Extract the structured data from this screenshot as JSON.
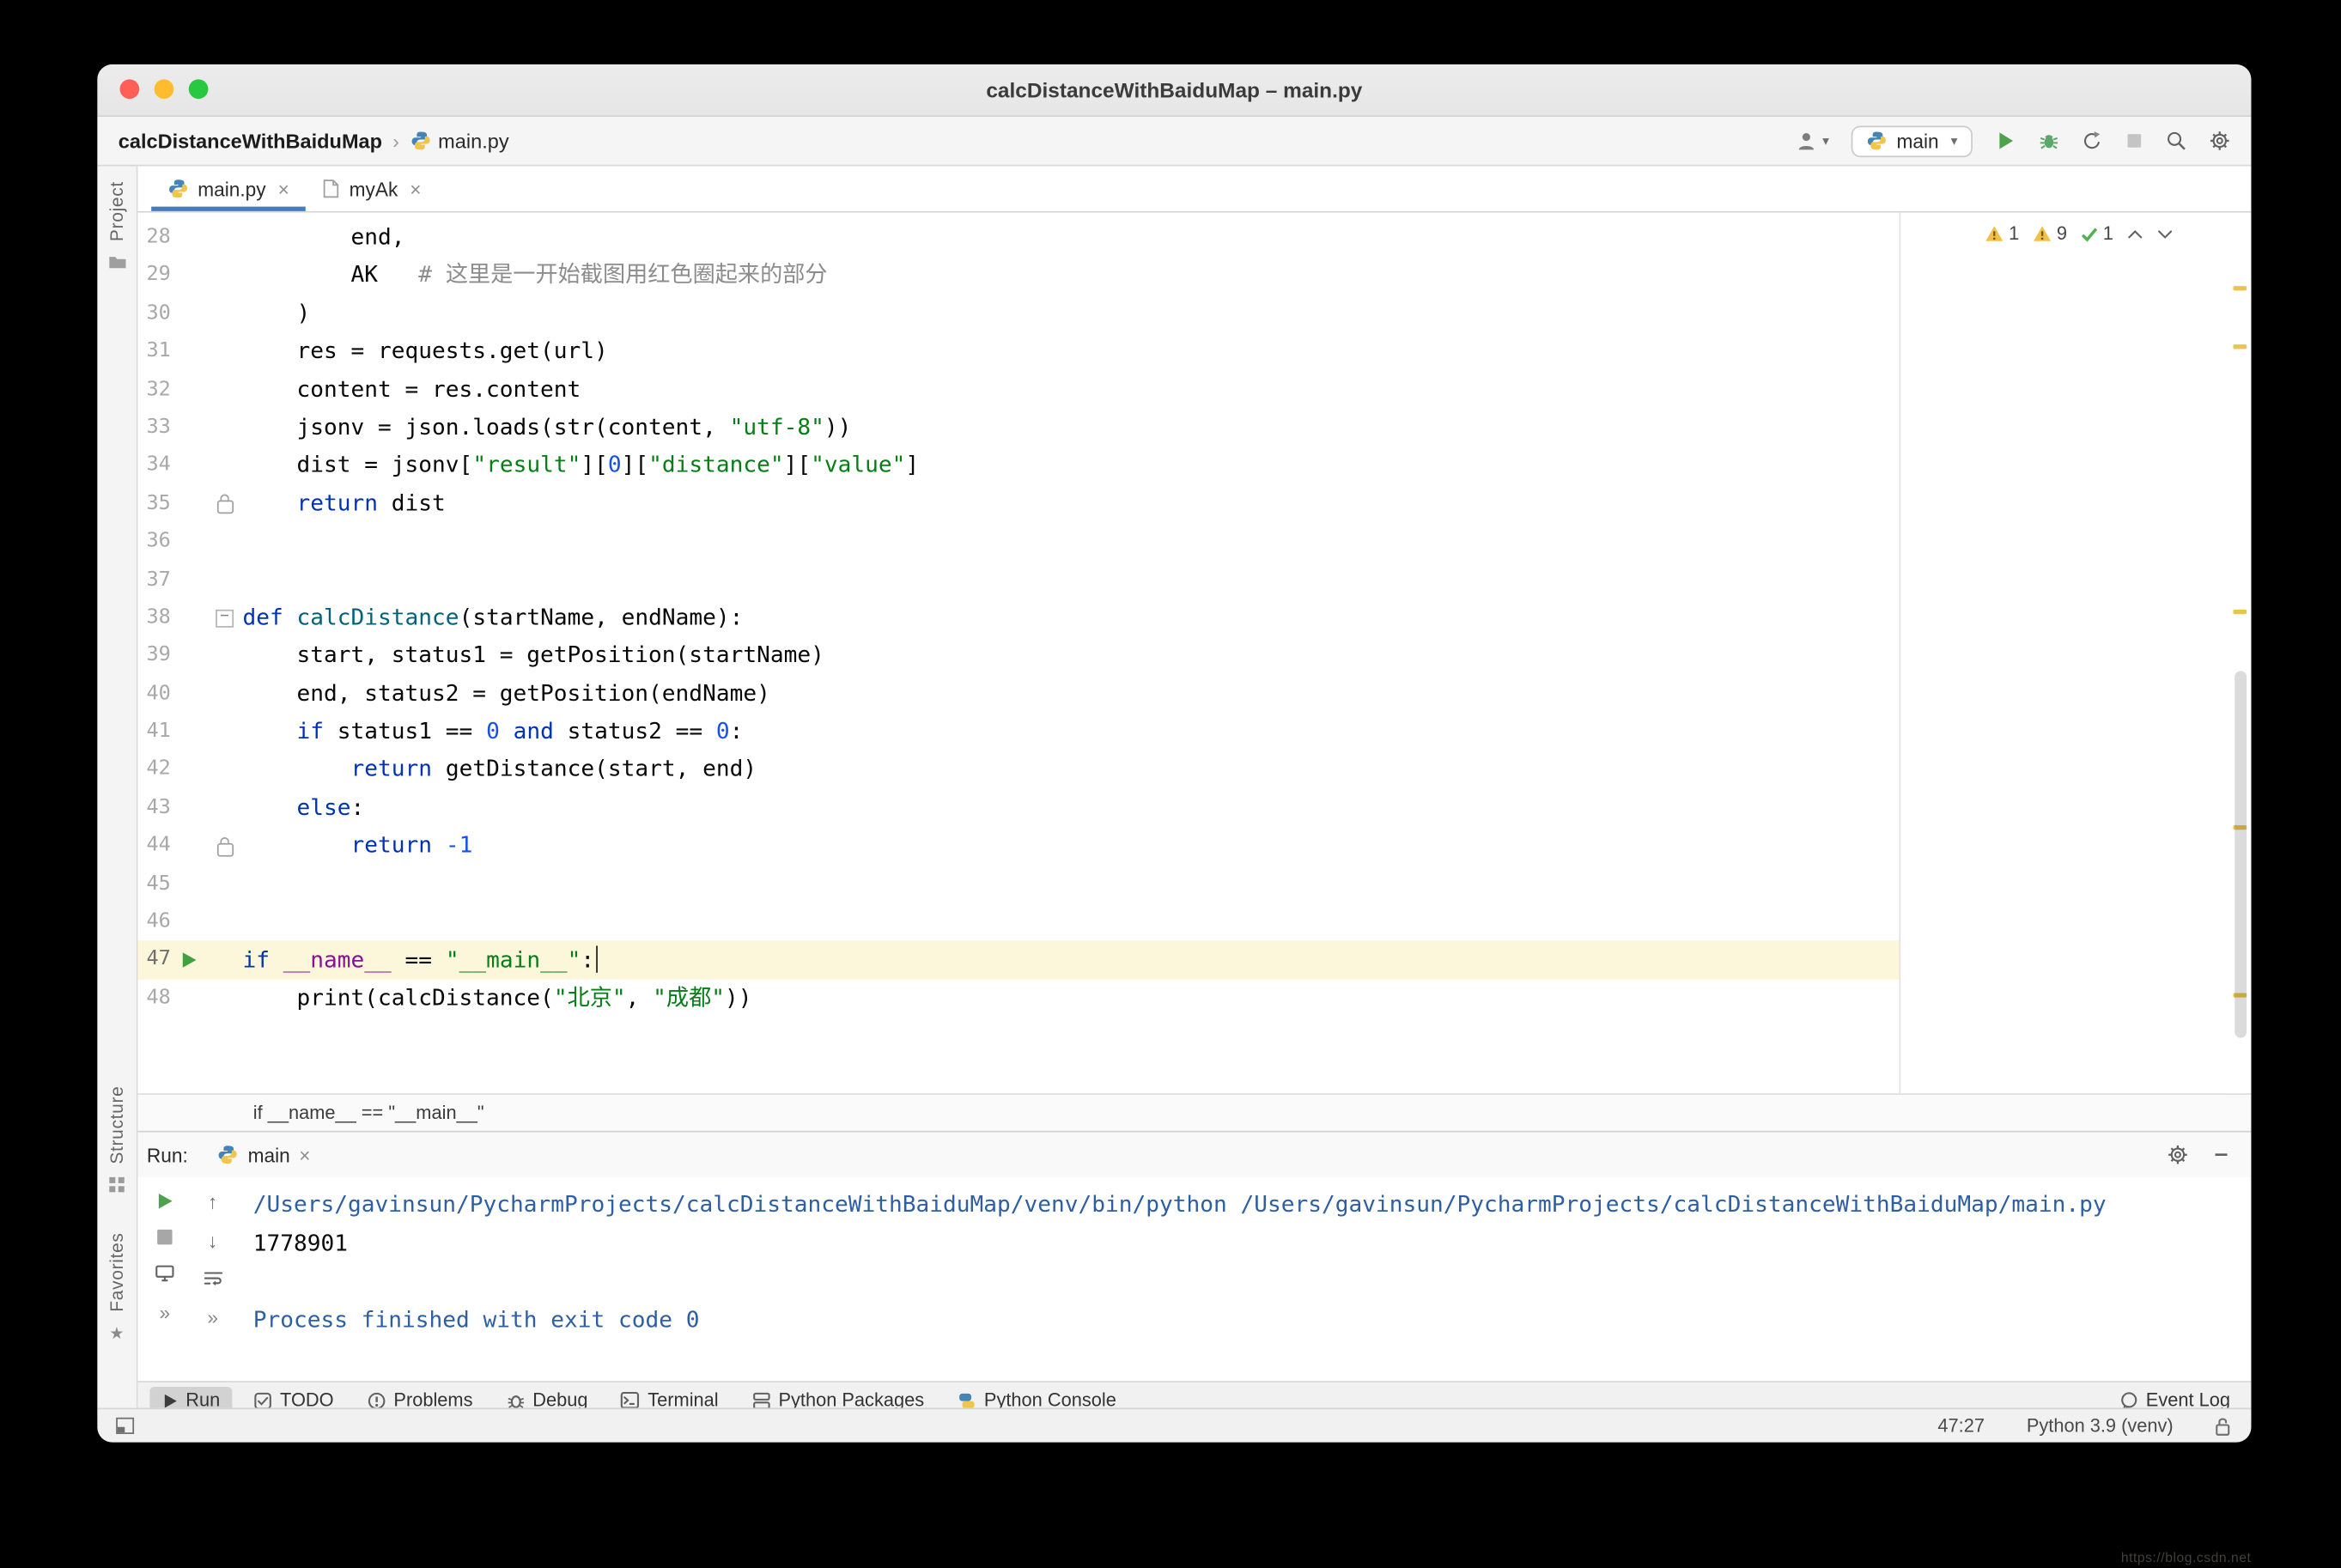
{
  "window": {
    "title": "calcDistanceWithBaiduMap – main.py"
  },
  "navbar": {
    "project": "calcDistanceWithBaiduMap",
    "separator": "›",
    "file": "main.py",
    "run_config": "main"
  },
  "tabs": [
    {
      "label": "main.py",
      "active": true
    },
    {
      "label": "myAk",
      "active": false
    }
  ],
  "inspections": {
    "warning1": "1",
    "warning2": "9",
    "passed": "1"
  },
  "side": {
    "project": "Project",
    "structure": "Structure",
    "favorites": "Favorites"
  },
  "editor": {
    "lines": [
      {
        "n": "28",
        "seg": [
          [
            "pln",
            "        end,"
          ]
        ]
      },
      {
        "n": "29",
        "seg": [
          [
            "pln",
            "        AK   "
          ],
          [
            "com",
            "# 这里是一开始截图用红色圈起来的部分"
          ]
        ]
      },
      {
        "n": "30",
        "seg": [
          [
            "pln",
            "    )"
          ]
        ]
      },
      {
        "n": "31",
        "seg": [
          [
            "pln",
            "    res = requests.get(url)"
          ]
        ]
      },
      {
        "n": "32",
        "seg": [
          [
            "pln",
            "    content = res.content"
          ]
        ]
      },
      {
        "n": "33",
        "seg": [
          [
            "pln",
            "    jsonv = json.loads(str(content, "
          ],
          [
            "str",
            "\"utf-8\""
          ],
          [
            "pln",
            "))"
          ]
        ]
      },
      {
        "n": "34",
        "seg": [
          [
            "pln",
            "    dist = jsonv["
          ],
          [
            "str",
            "\"result\""
          ],
          [
            "pln",
            "]["
          ],
          [
            "num",
            "0"
          ],
          [
            "pln",
            "]["
          ],
          [
            "str",
            "\"distance\""
          ],
          [
            "pln",
            "]["
          ],
          [
            "str",
            "\"value\""
          ],
          [
            "pln",
            "]"
          ]
        ]
      },
      {
        "n": "35",
        "g2": "lock",
        "seg": [
          [
            "pln",
            "    "
          ],
          [
            "kw",
            "return"
          ],
          [
            "pln",
            " dist"
          ]
        ]
      },
      {
        "n": "36",
        "seg": []
      },
      {
        "n": "37",
        "seg": []
      },
      {
        "n": "38",
        "g2": "fold",
        "seg": [
          [
            "kw",
            "def"
          ],
          [
            "pln",
            " "
          ],
          [
            "fn",
            "calcDistance"
          ],
          [
            "pln",
            "(startName, endName):"
          ]
        ]
      },
      {
        "n": "39",
        "seg": [
          [
            "pln",
            "    start, status1 = getPosition(startName)"
          ]
        ]
      },
      {
        "n": "40",
        "seg": [
          [
            "pln",
            "    end, status2 = getPosition(endName)"
          ]
        ]
      },
      {
        "n": "41",
        "seg": [
          [
            "pln",
            "    "
          ],
          [
            "kw",
            "if"
          ],
          [
            "pln",
            " status1 == "
          ],
          [
            "num",
            "0"
          ],
          [
            "pln",
            " "
          ],
          [
            "kw",
            "and"
          ],
          [
            "pln",
            " status2 == "
          ],
          [
            "num",
            "0"
          ],
          [
            "pln",
            ":"
          ]
        ]
      },
      {
        "n": "42",
        "seg": [
          [
            "pln",
            "        "
          ],
          [
            "kw",
            "return"
          ],
          [
            "pln",
            " getDistance(start, end)"
          ]
        ]
      },
      {
        "n": "43",
        "seg": [
          [
            "pln",
            "    "
          ],
          [
            "kw",
            "else"
          ],
          [
            "pln",
            ":"
          ]
        ]
      },
      {
        "n": "44",
        "g2": "lock",
        "seg": [
          [
            "pln",
            "        "
          ],
          [
            "kw",
            "return"
          ],
          [
            "pln",
            " "
          ],
          [
            "num",
            "-1"
          ]
        ]
      },
      {
        "n": "45",
        "seg": []
      },
      {
        "n": "46",
        "seg": []
      },
      {
        "n": "47",
        "g1": "run",
        "caret": true,
        "seg": [
          [
            "kw",
            "if"
          ],
          [
            "pln",
            " "
          ],
          [
            "dun",
            "__name__"
          ],
          [
            "pln",
            " == "
          ],
          [
            "str",
            "\"__main__\""
          ],
          [
            "pln",
            ":"
          ]
        ]
      },
      {
        "n": "48",
        "seg": [
          [
            "pln",
            "    print(calcDistance("
          ],
          [
            "str",
            "\"北京\""
          ],
          [
            "pln",
            ", "
          ],
          [
            "str",
            "\"成都\""
          ],
          [
            "pln",
            "))"
          ]
        ]
      }
    ]
  },
  "context_bar": "if __name__ == \"__main__\"",
  "run_panel": {
    "label": "Run:",
    "tab_label": "main",
    "console": [
      {
        "cls": "sys",
        "text": "/Users/gavinsun/PycharmProjects/calcDistanceWithBaiduMap/venv/bin/python /Users/gavinsun/PycharmProjects/calcDistanceWithBaiduMap/main.py"
      },
      {
        "cls": "out",
        "text": "1778901"
      },
      {
        "cls": "out",
        "text": ""
      },
      {
        "cls": "sys",
        "text": "Process finished with exit code 0"
      }
    ]
  },
  "toolbar": {
    "items": [
      {
        "label": "Run",
        "icon": "play-icon",
        "active": true
      },
      {
        "label": "TODO",
        "icon": "todo-icon"
      },
      {
        "label": "Problems",
        "icon": "problems-icon"
      },
      {
        "label": "Debug",
        "icon": "debug-icon"
      },
      {
        "label": "Terminal",
        "icon": "terminal-icon"
      },
      {
        "label": "Python Packages",
        "icon": "packages-icon"
      },
      {
        "label": "Python Console",
        "icon": "python-console-icon"
      }
    ],
    "right_label": "Event Log"
  },
  "statusbar": {
    "caret_position": "47:27",
    "interpreter": "Python 3.9 (venv)"
  },
  "watermark": "https://blog.csdn.net",
  "colors": {
    "accent_tab": "#3d7fc1",
    "warning": "#e9c64b",
    "passed": "#4db34d",
    "keyword": "#0033b3",
    "string": "#067d17",
    "number": "#1750eb",
    "comment": "#8c8c8c"
  }
}
